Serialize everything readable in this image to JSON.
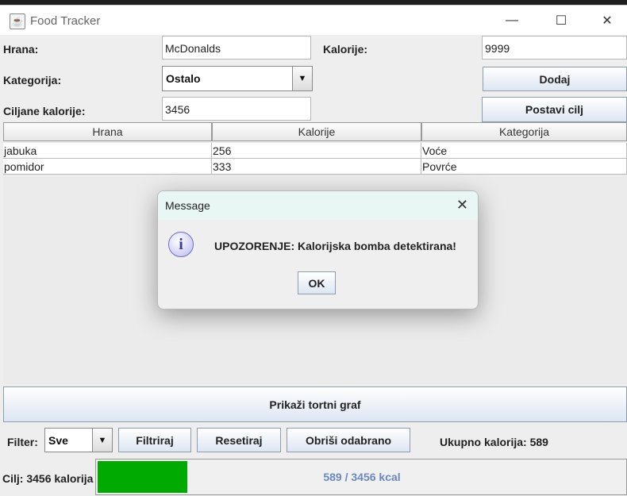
{
  "window": {
    "title": "Food Tracker",
    "minimize": "—",
    "maximize": "☐",
    "close": "✕"
  },
  "form": {
    "food_label": "Hrana:",
    "food_value": "McDonalds",
    "calories_label": "Kalorije:",
    "calories_value": "9999",
    "category_label": "Kategorija:",
    "category_value": "Ostalo",
    "add_button": "Dodaj",
    "target_label": "Ciljane kalorije:",
    "target_value": "3456",
    "set_target_button": "Postavi cilj"
  },
  "table": {
    "headers": [
      "Hrana",
      "Kalorije",
      "Kategorija"
    ],
    "rows": [
      [
        "jabuka",
        "256",
        "Voće"
      ],
      [
        "pomidor",
        "333",
        "Povrće"
      ]
    ]
  },
  "pie_button": "Prikaži tortni graf",
  "filter": {
    "label": "Filter:",
    "value": "Sve",
    "filter_button": "Filtriraj",
    "reset_button": "Resetiraj",
    "delete_button": "Obriši odabrano",
    "total_label": "Ukupno kalorija: 589"
  },
  "goal": {
    "label": "Cilj: 3456 kalorija",
    "progress_text": "589 / 3456 kcal",
    "progress_fraction": 0.17,
    "fill_color": "#00aa00"
  },
  "dialog": {
    "title": "Message",
    "message": "UPOZORENJE: Kalorijska bomba detektirana!",
    "ok_button": "OK",
    "icon": "info-icon"
  }
}
